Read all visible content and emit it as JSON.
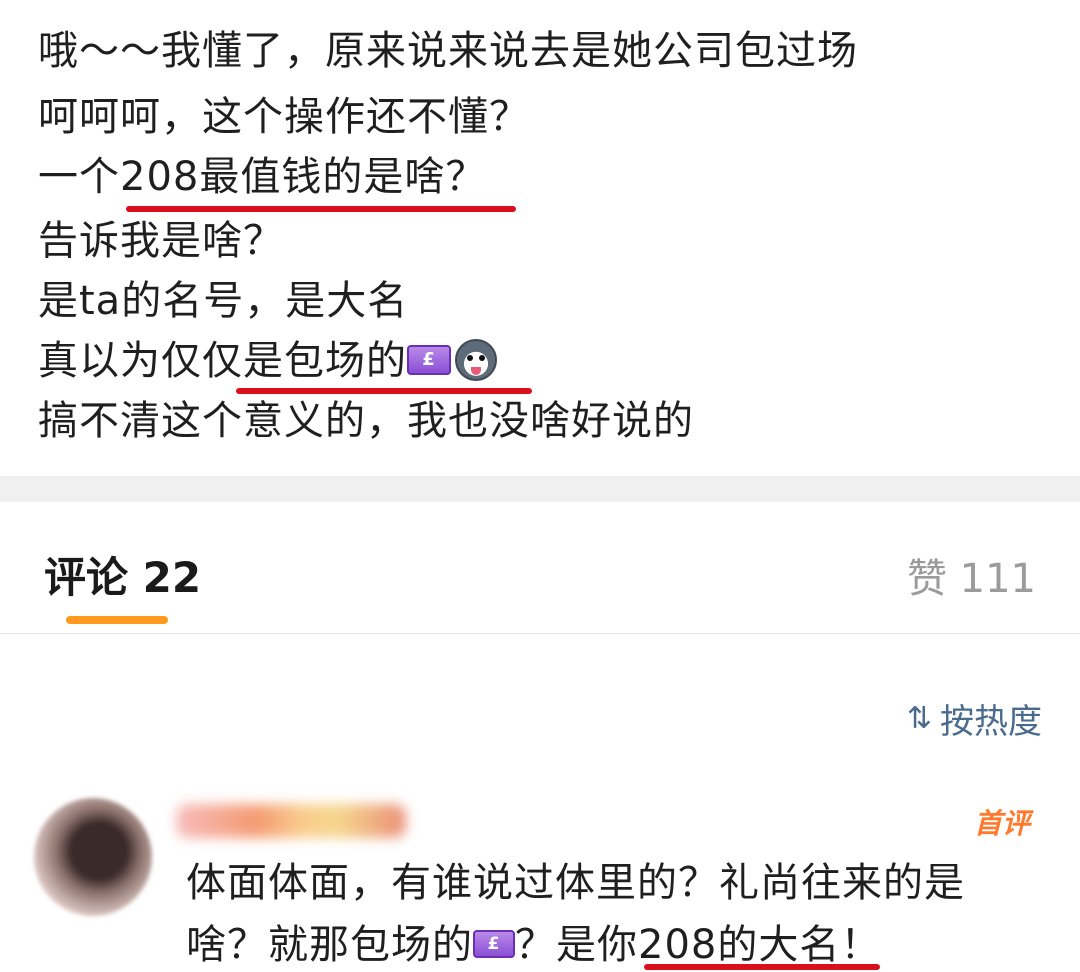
{
  "post": {
    "lines": [
      "哦～～我懂了，原来说来说去是她公司包过场",
      "呵呵呵，这个操作还不懂？",
      "一个208最值钱的是啥？",
      "告诉我是啥？",
      "是ta的名号，是大名",
      "真以为仅仅是包场的",
      "搞不清这个意义的，我也没啥好说的"
    ],
    "emoji_money": "£",
    "emoji_names": [
      "money-bag-emoji",
      "husky-dog-emoji"
    ]
  },
  "tabs": {
    "comments_label": "评论 22",
    "likes_label": "赞 111"
  },
  "sort": {
    "icon": "⇅",
    "label": "按热度"
  },
  "comment": {
    "badge": "首评",
    "lines": [
      "体面体面，有谁说过体里的？礼尚往来的是",
      "啥？就那包场的",
      "？是你208的大名！"
    ]
  },
  "colors": {
    "underline": "#d9101c",
    "tab_indicator": "#ff9a1e",
    "sort_text": "#4a6b8e",
    "badge": "#ff7a2e",
    "band": "#f0f0f0"
  }
}
